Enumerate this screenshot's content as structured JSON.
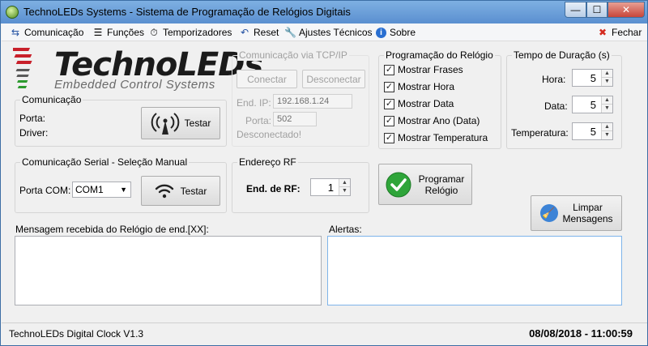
{
  "window": {
    "title": "TechnoLEDs Systems - Sistema de Programação de Relógios Digitais",
    "min": "—",
    "max": "☐",
    "close": "✕"
  },
  "menu": {
    "comunicacao": "Comunicação",
    "funcoes": "Funções",
    "temporizadores": "Temporizadores",
    "reset": "Reset",
    "ajustes": "Ajustes Técnicos",
    "sobre": "Sobre",
    "fechar": "Fechar"
  },
  "logo": {
    "name": "TechnoLEDs",
    "tagline": "Embedded Control Systems"
  },
  "comunicacao": {
    "title": "Comunicação",
    "porta_label": "Porta:",
    "driver_label": "Driver:",
    "test_label": "Testar"
  },
  "tcp": {
    "title": "Comunicação via TCP/IP",
    "connect": "Conectar",
    "disconnect": "Desconectar",
    "ip_label": "End. IP:",
    "ip_value": "192.168.1.24",
    "port_label": "Porta:",
    "port_value": "502",
    "status": "Desconectado!"
  },
  "programacao": {
    "title": "Programação do Relógio",
    "options": [
      {
        "label": "Mostrar Frases",
        "checked": "✓"
      },
      {
        "label": "Mostrar Hora",
        "checked": "✓"
      },
      {
        "label": "Mostrar Data",
        "checked": "✓"
      },
      {
        "label": "Mostrar Ano (Data)",
        "checked": "✓"
      },
      {
        "label": "Mostrar Temperatura",
        "checked": "✓"
      }
    ]
  },
  "duracao": {
    "title": "Tempo de Duração (s)",
    "hora_label": "Hora:",
    "hora_value": "5",
    "data_label": "Data:",
    "data_value": "5",
    "temp_label": "Temperatura:",
    "temp_value": "5"
  },
  "serial": {
    "title": "Comunicação Serial - Seleção Manual",
    "porta_label": "Porta COM:",
    "porta_value": "COM1",
    "test_label": "Testar"
  },
  "rf": {
    "title": "Endereço RF",
    "label": "End. de RF:",
    "value": "1"
  },
  "actions": {
    "programar": "Programar Relógio",
    "limpar": "Limpar Mensagens"
  },
  "messages": {
    "received_label": "Mensagem recebida do Relógio de end.[XX]:",
    "alerts_label": "Alertas:"
  },
  "status": {
    "version": "TechnoLEDs Digital Clock V1.3",
    "datetime": "08/08/2018 - 11:00:59"
  }
}
